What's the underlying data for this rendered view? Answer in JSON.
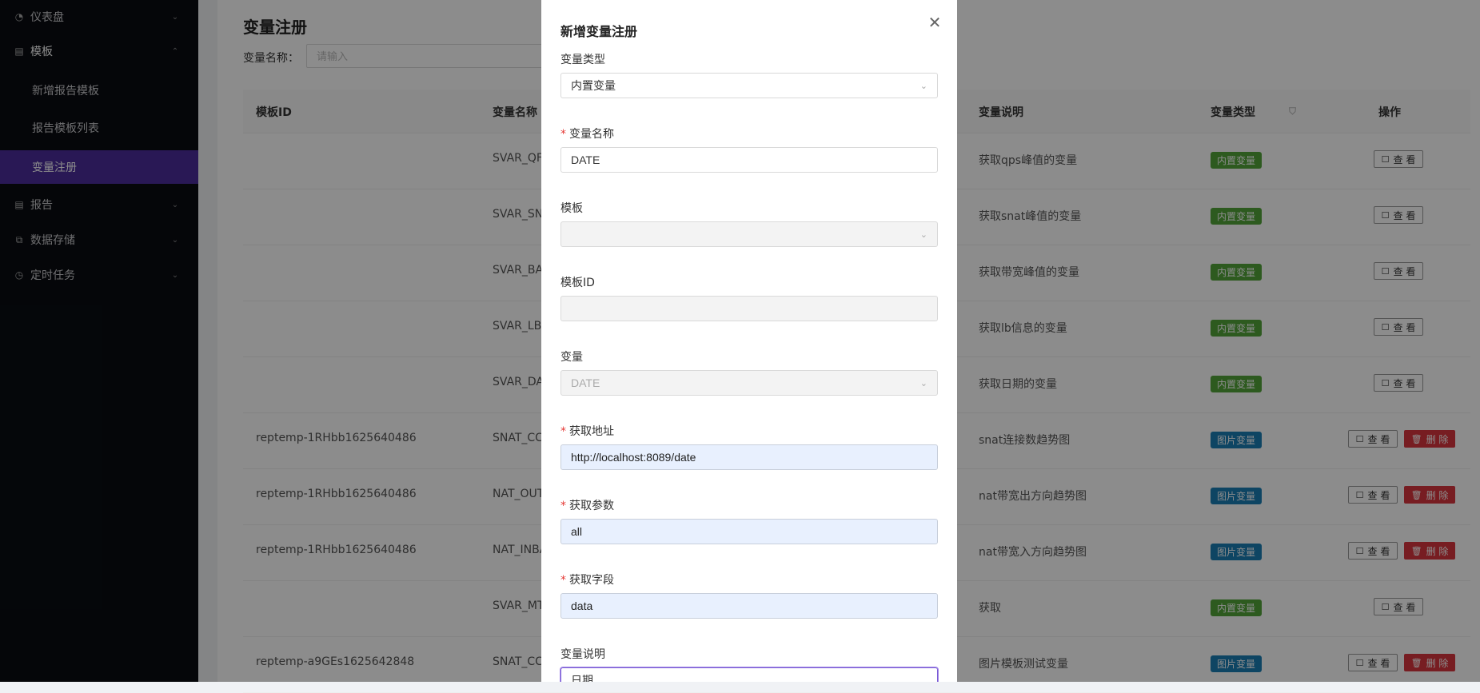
{
  "sidebar": {
    "items": [
      {
        "label": "仪表盘",
        "icon": "dashboard-icon"
      },
      {
        "label": "模板",
        "icon": "template-icon"
      },
      {
        "label": "报告",
        "icon": "report-icon"
      },
      {
        "label": "数据存储",
        "icon": "chart-icon"
      },
      {
        "label": "定时任务",
        "icon": "clock-icon"
      }
    ],
    "sub_items": [
      {
        "label": "新增报告模板"
      },
      {
        "label": "报告模板列表"
      },
      {
        "label": "变量注册"
      }
    ]
  },
  "page": {
    "title": "变量注册",
    "filter_label": "变量名称：",
    "filter_placeholder": "请输入"
  },
  "table": {
    "columns": [
      "模板ID",
      "变量名称",
      "变量说明",
      "变量类型",
      "操作"
    ],
    "view_label": "查 看",
    "delete_label": "删 除",
    "rows": [
      {
        "template_id": "",
        "name": "SVAR_QF",
        "desc": "获取qps峰值的变量",
        "type": "内置变量",
        "type_color": "#52a43a",
        "delete": false
      },
      {
        "template_id": "",
        "name": "SVAR_SN",
        "desc": "获取snat峰值的变量",
        "type": "内置变量",
        "type_color": "#52a43a",
        "delete": false
      },
      {
        "template_id": "",
        "name": "SVAR_BA",
        "desc": "获取带宽峰值的变量",
        "type": "内置变量",
        "type_color": "#52a43a",
        "delete": false
      },
      {
        "template_id": "",
        "name": "SVAR_LB",
        "desc": "获取lb信息的变量",
        "type": "内置变量",
        "type_color": "#52a43a",
        "delete": false
      },
      {
        "template_id": "",
        "name": "SVAR_DA",
        "desc": "获取日期的变量",
        "type": "内置变量",
        "type_color": "#52a43a",
        "delete": false
      },
      {
        "template_id": "reptemp-1RHbb1625640486",
        "name": "SNAT_CC",
        "desc": "snat连接数趋势图",
        "type": "图片变量",
        "type_color": "#1a7fb5",
        "delete": true
      },
      {
        "template_id": "reptemp-1RHbb1625640486",
        "name": "NAT_OUT",
        "desc": "nat带宽出方向趋势图",
        "type": "图片变量",
        "type_color": "#1a7fb5",
        "delete": true
      },
      {
        "template_id": "reptemp-1RHbb1625640486",
        "name": "NAT_INBA",
        "desc": "nat带宽入方向趋势图",
        "type": "图片变量",
        "type_color": "#1a7fb5",
        "delete": true
      },
      {
        "template_id": "",
        "name": "SVAR_MT",
        "desc": "获取",
        "type": "内置变量",
        "type_color": "#52a43a",
        "delete": false
      },
      {
        "template_id": "reptemp-a9GEs1625642848",
        "name": "SNAT_CC",
        "desc": "图片模板测试变量",
        "type": "图片变量",
        "type_color": "#1a7fb5",
        "delete": true
      }
    ]
  },
  "modal": {
    "title": "新增变量注册",
    "fields": {
      "var_type": {
        "label": "变量类型",
        "value": "内置变量"
      },
      "var_name": {
        "label": "变量名称",
        "value": "DATE"
      },
      "template": {
        "label": "模板",
        "value": ""
      },
      "template_id": {
        "label": "模板ID",
        "value": ""
      },
      "variable": {
        "label": "变量",
        "value": "DATE"
      },
      "fetch_url": {
        "label": "获取地址",
        "value": "http://localhost:8089/date"
      },
      "fetch_params": {
        "label": "获取参数",
        "value": "all"
      },
      "fetch_field": {
        "label": "获取字段",
        "value": "data"
      },
      "description": {
        "label": "变量说明",
        "value": "日期"
      }
    }
  }
}
